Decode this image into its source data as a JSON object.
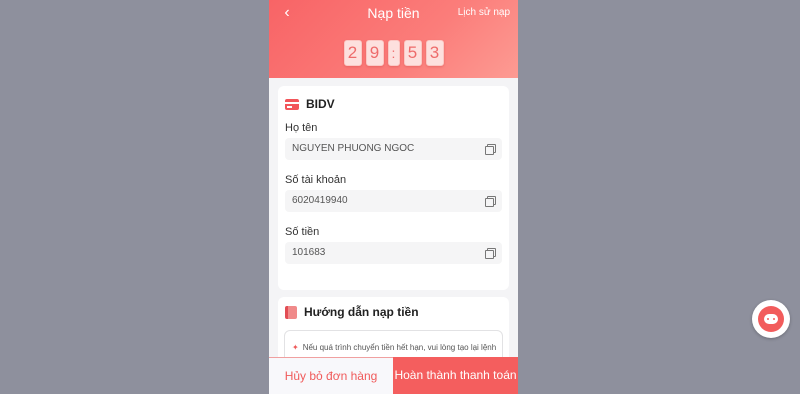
{
  "header": {
    "back_icon": "chevron-left-icon",
    "title": "Nạp tiền",
    "history_label": "Lịch sử nạp"
  },
  "timer": {
    "digits": [
      "2",
      "9",
      ":",
      "5",
      "3"
    ]
  },
  "bank": {
    "icon": "credit-card-icon",
    "name": "BIDV",
    "fields": [
      {
        "label": "Họ tên",
        "value": "NGUYEN PHUONG NGOC"
      },
      {
        "label": "Số tài khoản",
        "value": "6020419940"
      },
      {
        "label": "Số tiền",
        "value": "101683"
      }
    ]
  },
  "guide": {
    "icon": "book-icon",
    "title": "Hướng dẫn nạp tiền",
    "note": "Nếu quá trình chuyển tiền hết hạn, vui lòng tạo lại lệnh"
  },
  "actions": {
    "cancel_label": "Hủy bỏ đơn hàng",
    "complete_label": "Hoàn thành thanh toán"
  },
  "colors": {
    "accent": "#f45e5e",
    "header_gradient_start": "#f86466",
    "header_gradient_end": "#fd9b93",
    "backdrop": "#8e909d"
  },
  "support": {
    "icon": "chat-support-icon"
  }
}
